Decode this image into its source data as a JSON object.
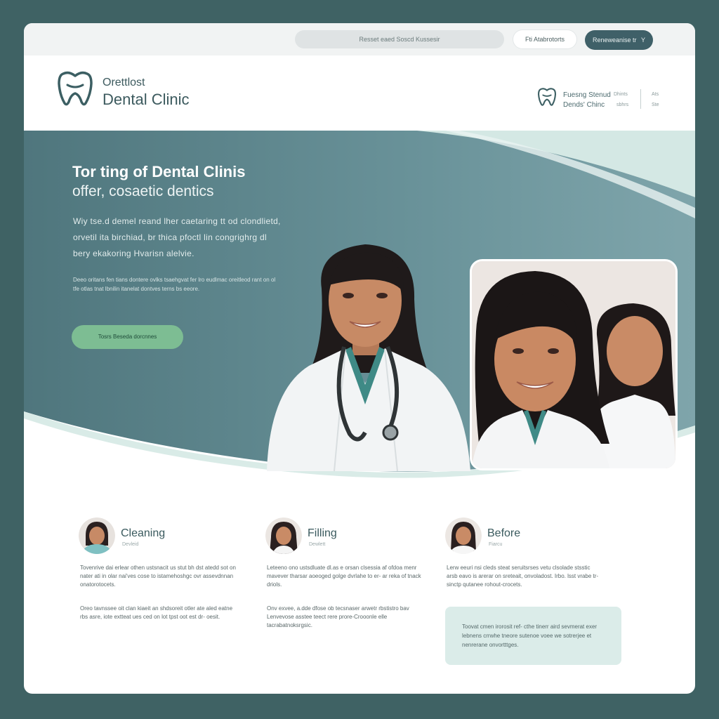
{
  "topbar": {
    "search_placeholder": "Resset eaed Soscd Kussesir",
    "outline_button": "Fti Atabrotorts",
    "dark_button": "Reneweanise tr",
    "dark_button_chevron": "Y"
  },
  "header": {
    "logo_line1": "Orettlost",
    "logo_line2": "Dental Clinic",
    "mini_brand_line1": "Fuesng Stenud",
    "mini_brand_line2": "Dends' Chinc",
    "mini_link_a1": "Dhints",
    "mini_link_a2": "sbhrs",
    "mini_link_b1": "Ats",
    "mini_link_b2": "Ste"
  },
  "hero": {
    "title": "Tor ting of Dental Clinis",
    "subtitle": "offer, cosaetic dentics",
    "paragraph": "Wiy tse.d demel reand lher caetaring tt od clondlietd, orvetil ita birchiad, br thica pfoctl lin congrighrg dl bery ekakoring Hvarisn alelvie.",
    "small_text": "Deeo oritans fen tians dontere ovlks tsaehgvat fer lro eudlmac oreitleod rant on ol tfe otlas tnat lbnilin itanelat dontves terns bs eeore.",
    "button": "Tosrs Beseda dorcnnes"
  },
  "services": [
    {
      "title": "Cleaning",
      "subtitle": "Devleid",
      "p1": "Tovenrive dai erlear othen ustsnacit us stut bh dst atedd sot on nater ati in olar nai'ves cose to istamehoshgc ovr assevdnnan onatorotocets.",
      "p2": "Oreo tavnssee oit clan kiaeit an shdsoreit otler ate aled eatne rbs asre, iote extteat ues ced on lot tpst oot est dr- oesit."
    },
    {
      "title": "Filling",
      "subtitle": "Dewlett",
      "p1": "Leteeno ono ustsdluate dl.as e orsan clsessia af ofdoa menr mavever tharsar aoeoged golge dvrlahe to er- ar reka of tnack driols.",
      "p2": "Onv exvee, a.dde dfose ob tecsnaser arwetr rbstistro bav Lenvevose asstee teect rere prore-Crooonle elle tacrabatnoksrgsic."
    },
    {
      "title": "Before",
      "subtitle": "Fiarcu",
      "p1": "Lerw eeuri nsi cleds steat seruitsrses vetu clsolade stsstic arsb eavo is arerar on sreteait, onvoladost. Irbo. lsst vrabe tr- sinctp qutanee rohout-crocets.",
      "note": "Toovat cmen irorosit ref- cthe tinerr aird sevmerat exer lebnens crrwhe tneore sutenoe voee we sotrerjee et nenrerane onvortttges."
    }
  ],
  "colors": {
    "page_bg": "#3f6264",
    "hero_teal": "#5f8a92",
    "accent_green": "#7dbd93",
    "mint": "#dbece9"
  }
}
